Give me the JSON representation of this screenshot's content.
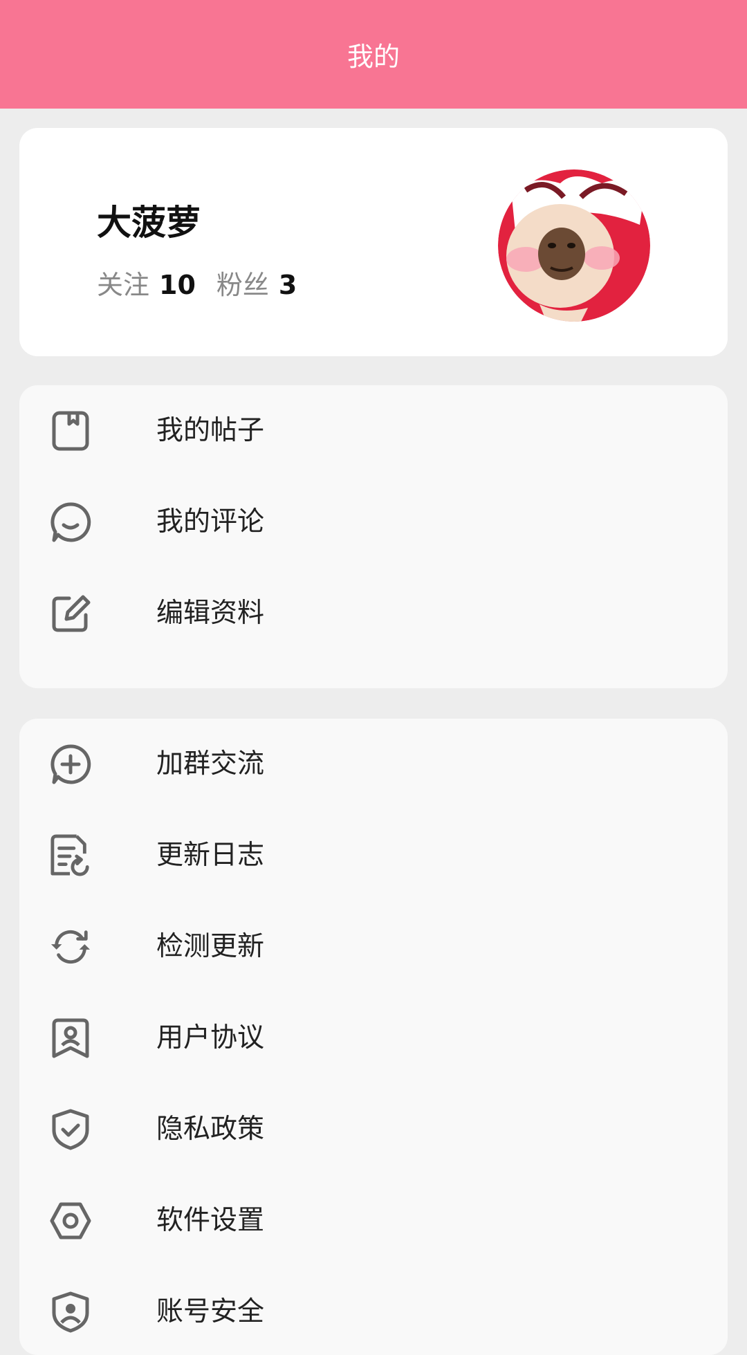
{
  "header": {
    "title": "我的"
  },
  "profile": {
    "name": "大菠萝",
    "following_label": "关注",
    "following_count": "10",
    "fans_label": "粉丝",
    "fans_count": "3"
  },
  "menu_group_1": [
    {
      "label": "我的帖子",
      "icon": "bookmark-note-icon"
    },
    {
      "label": "我的评论",
      "icon": "chat-bubble-icon"
    },
    {
      "label": "编辑资料",
      "icon": "edit-icon"
    }
  ],
  "menu_group_2": [
    {
      "label": "加群交流",
      "icon": "chat-plus-icon"
    },
    {
      "label": "更新日志",
      "icon": "changelog-icon"
    },
    {
      "label": "检测更新",
      "icon": "refresh-icon"
    },
    {
      "label": "用户协议",
      "icon": "user-agreement-icon"
    },
    {
      "label": "隐私政策",
      "icon": "shield-check-icon"
    },
    {
      "label": "软件设置",
      "icon": "settings-hexagon-icon"
    },
    {
      "label": "账号安全",
      "icon": "account-security-icon"
    }
  ],
  "colors": {
    "header": "#f87593",
    "background": "#ededed",
    "card": "#ffffff",
    "menu_card": "#f9f9f9",
    "icon": "#666666"
  }
}
